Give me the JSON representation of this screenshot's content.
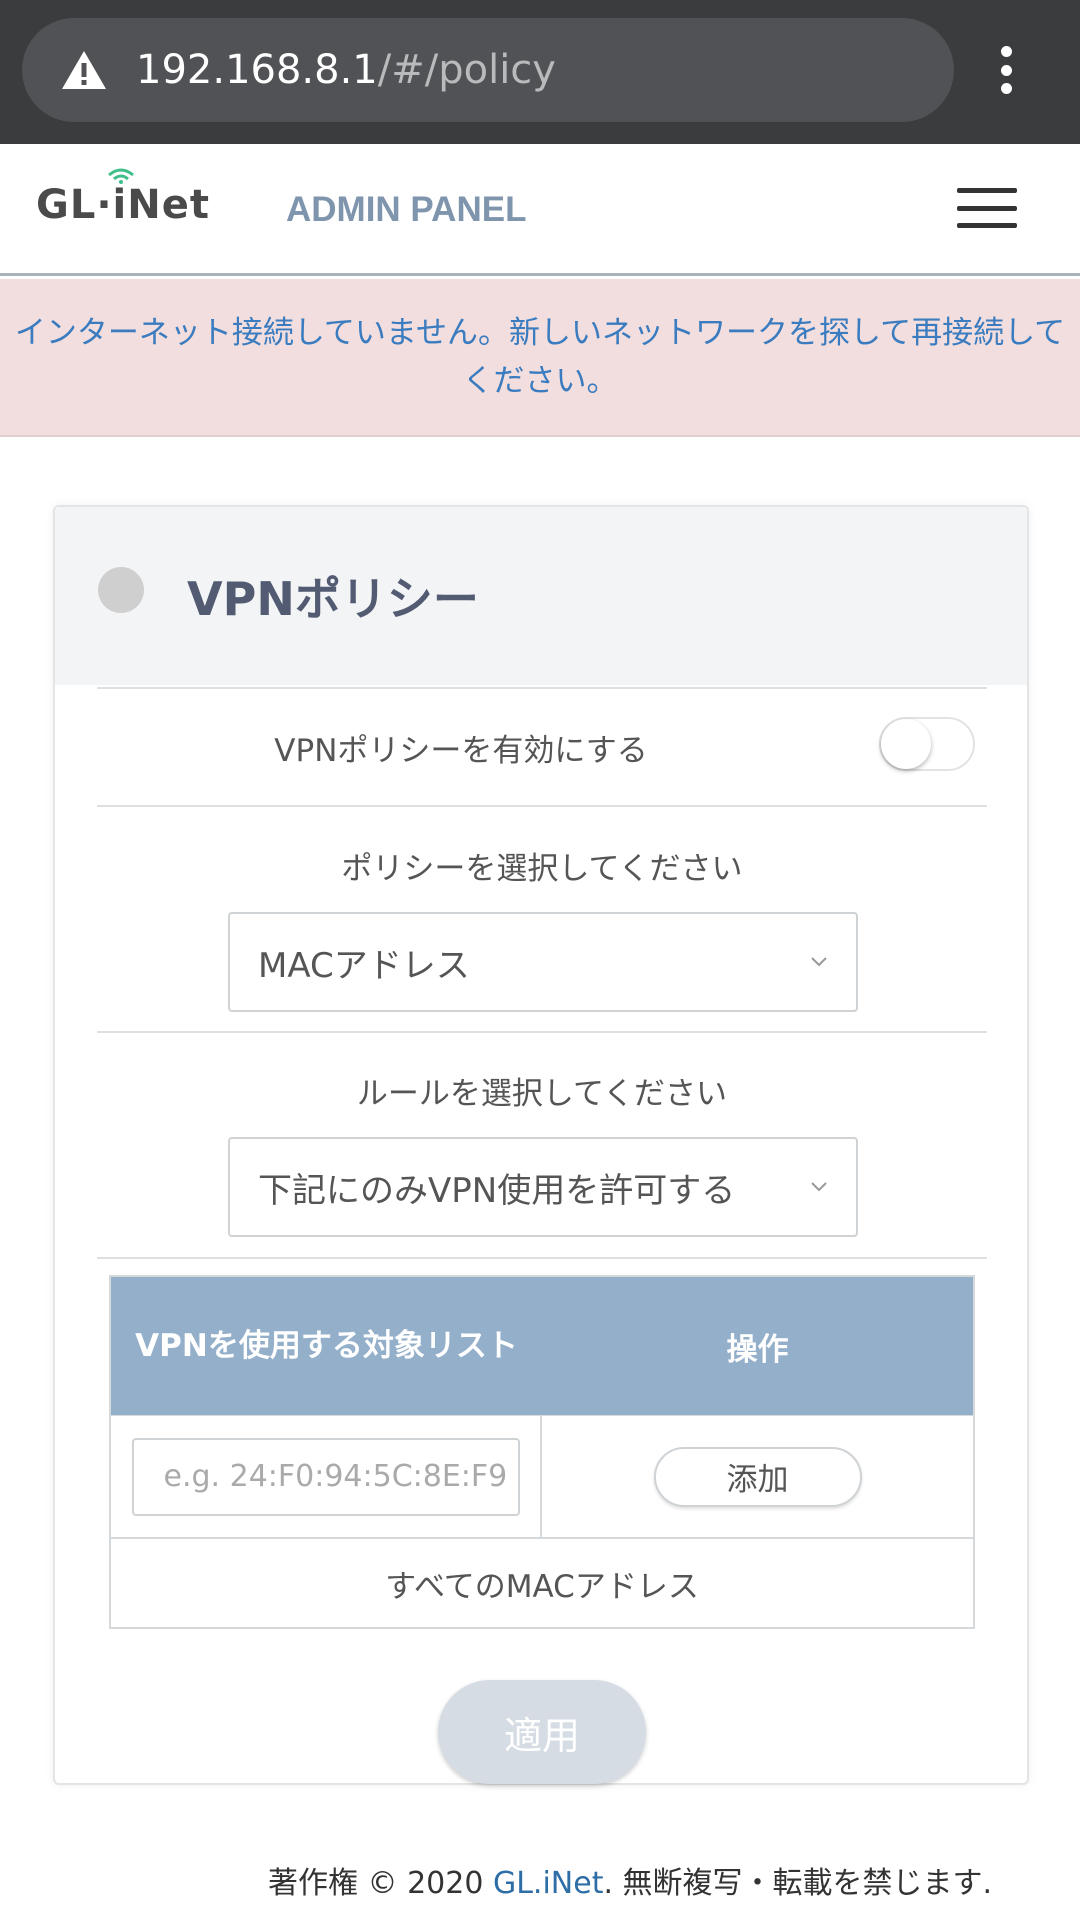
{
  "browser": {
    "url_host": "192.168.8.1",
    "url_path": "/#/policy"
  },
  "header": {
    "logo": "GL·iNet",
    "title": "ADMIN PANEL"
  },
  "alert": {
    "message": "インターネット接続していません。新しいネットワークを探して再接続してください。"
  },
  "card": {
    "title": "VPNポリシー",
    "enable_label": "VPNポリシーを有効にする",
    "enable_on": false,
    "policy_label": "ポリシーを選択してください",
    "policy_value": "MACアドレス",
    "rule_label": "ルールを選択してください",
    "rule_value": "下記にのみVPN使用を許可する",
    "table": {
      "col_target": "VPNを使用する対象リスト",
      "col_action": "操作",
      "mac_placeholder": "e.g. 24:F0:94:5C:8E:F9",
      "add_label": "添加",
      "all_label": "すべてのMACアドレス"
    },
    "apply_label": "適用"
  },
  "footer": {
    "prefix": "著作権 © 2020 ",
    "brand": "GL.iNet",
    "suffix": ". 無断複写・転載を禁じます."
  },
  "colors": {
    "header_accent": "#7e95ad",
    "alert_bg": "#f2dede",
    "alert_text": "#3a7cbf",
    "table_head": "#93afca"
  }
}
